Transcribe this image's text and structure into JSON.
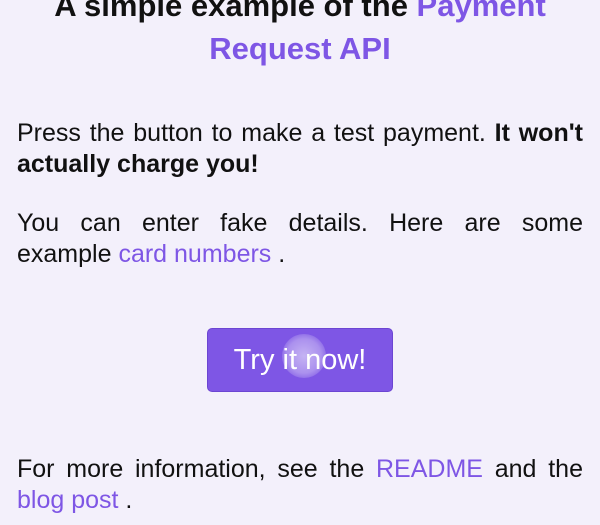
{
  "heading": {
    "text_before": "A simple example of the ",
    "accent_text": "Payment Request API"
  },
  "intro": {
    "text": "Press the button to make a test payment. ",
    "bold_text": "It won't actually charge you!"
  },
  "fake_details": {
    "text": "You can enter fake details. Here are some example ",
    "link_text": "card numbers",
    "suffix": "."
  },
  "try_button": {
    "label": "Try it now!"
  },
  "footer": {
    "prefix": "For more information, see the ",
    "readme_link": "README",
    "middle": " and the ",
    "blog_link": "blog post",
    "suffix": "."
  },
  "colors": {
    "accent": "#7e56e5",
    "background": "#f3f0fb",
    "text": "#111111",
    "button_text": "#ffffff"
  }
}
